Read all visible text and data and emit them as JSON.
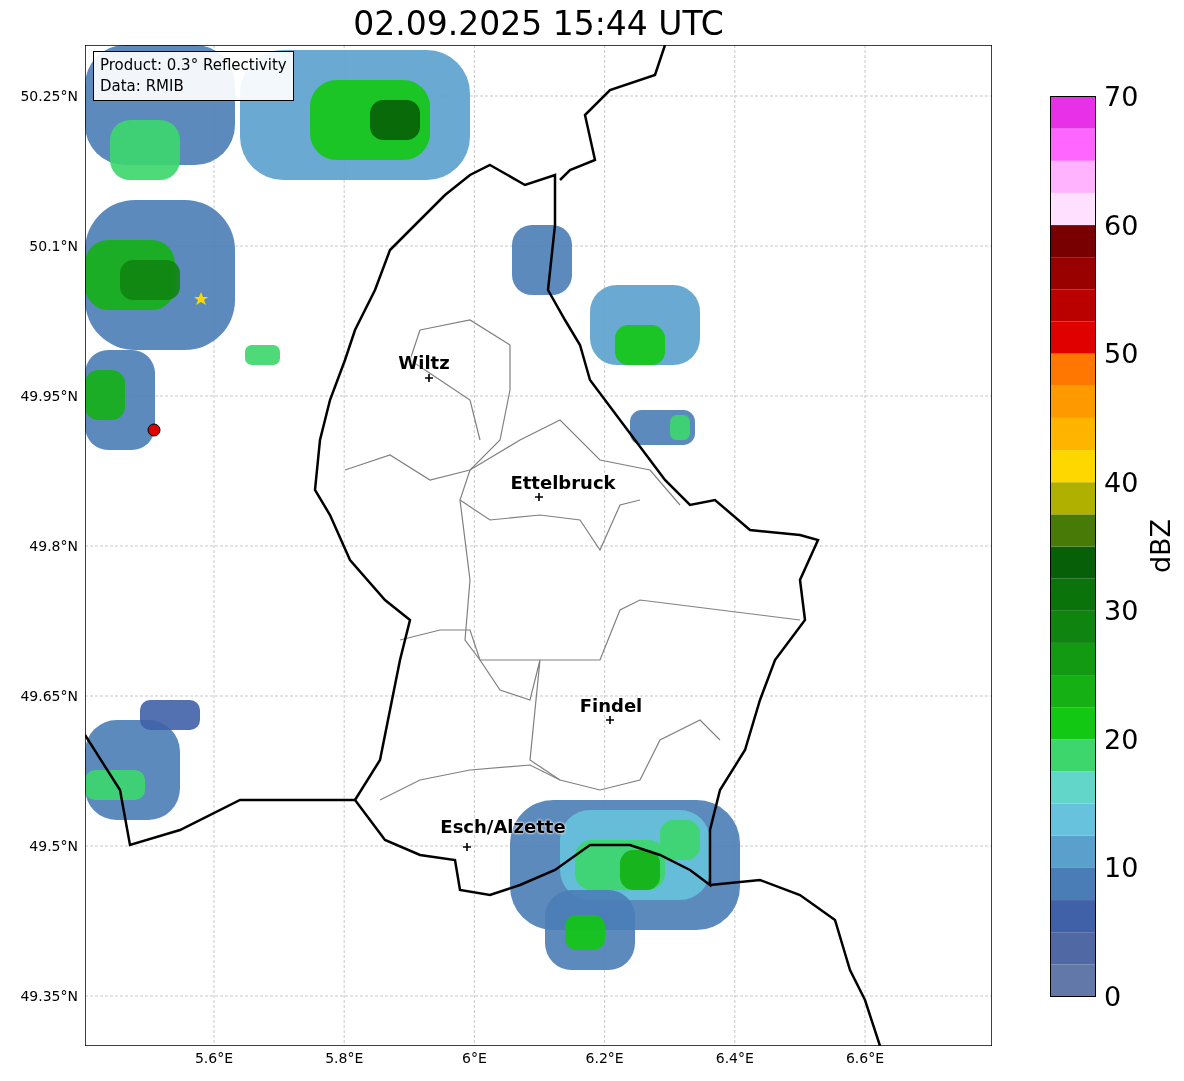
{
  "title": "02.09.2025 15:44 UTC",
  "info_box": {
    "lines": [
      "Product: 0.3° Reflectivity",
      "Data: RMIB"
    ]
  },
  "map": {
    "lat_ticks": [
      "50.25°N",
      "50.1°N",
      "49.95°N",
      "49.8°N",
      "49.65°N",
      "49.5°N",
      "49.35°N"
    ],
    "lon_ticks": [
      "5.6°E",
      "5.8°E",
      "6°E",
      "6.2°E",
      "6.4°E",
      "6.6°E"
    ],
    "cities": [
      {
        "name": "Wiltz"
      },
      {
        "name": "Ettelbruck"
      },
      {
        "name": "Findel"
      },
      {
        "name": "Esch/Alzette"
      }
    ]
  },
  "colorbar": {
    "label": "dBZ",
    "ticks": [
      "70",
      "60",
      "50",
      "40",
      "30",
      "20",
      "10",
      "0"
    ],
    "bands": [
      {
        "color": "#6278a8"
      },
      {
        "color": "#5068a4"
      },
      {
        "color": "#4060a8"
      },
      {
        "color": "#4a7db6"
      },
      {
        "color": "#5aa0cc"
      },
      {
        "color": "#66c2dd"
      },
      {
        "color": "#62d6c8"
      },
      {
        "color": "#3cd66c"
      },
      {
        "color": "#12c812"
      },
      {
        "color": "#14b014"
      },
      {
        "color": "#129a12"
      },
      {
        "color": "#0f840f"
      },
      {
        "color": "#0a740a"
      },
      {
        "color": "#075f07"
      },
      {
        "color": "#487a08"
      },
      {
        "color": "#b0b000"
      },
      {
        "color": "#ffd700"
      },
      {
        "color": "#ffb400"
      },
      {
        "color": "#ff9900"
      },
      {
        "color": "#ff7700"
      },
      {
        "color": "#e00000"
      },
      {
        "color": "#bb0000"
      },
      {
        "color": "#990000"
      },
      {
        "color": "#780000"
      },
      {
        "color": "#ffe0ff"
      },
      {
        "color": "#ffb3ff"
      },
      {
        "color": "#ff66ff"
      },
      {
        "color": "#e830e8"
      }
    ]
  }
}
